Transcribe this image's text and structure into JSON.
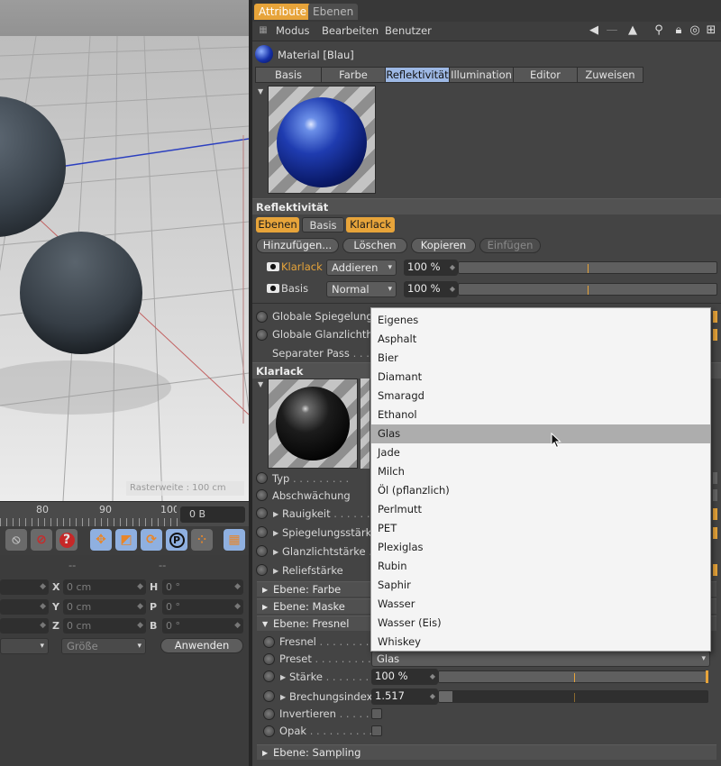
{
  "viewport": {
    "status_text": "Rasterweite : 100 cm"
  },
  "timeline": {
    "tick_labels": [
      "80",
      "90",
      "100"
    ],
    "frame_value": "0 B"
  },
  "left_toolbar": {
    "icons": [
      "scene-icon",
      "record-icon",
      "help-icon",
      "move-icon",
      "scale-icon",
      "rotate-icon",
      "parameter-icon",
      "points-icon",
      "film-icon"
    ]
  },
  "coordinates": {
    "header_dashes": [
      "--",
      "--"
    ],
    "rows": [
      {
        "a_value": "",
        "a_letter": "X",
        "a_field": "0 cm",
        "b_letter": "H",
        "b_field": "0 °"
      },
      {
        "a_value": "",
        "a_letter": "Y",
        "a_field": "0 cm",
        "b_letter": "P",
        "b_field": "0 °"
      },
      {
        "a_value": "",
        "a_letter": "Z",
        "a_field": "0 cm",
        "b_letter": "B",
        "b_field": "0 °"
      }
    ],
    "size_dropdown": "Größe",
    "apply_button": "Anwenden"
  },
  "panel": {
    "top_tabs": [
      "Attribute",
      "Ebenen"
    ],
    "menu": [
      "Modus",
      "Bearbeiten",
      "Benutzer"
    ],
    "material_title": "Material [Blau]",
    "channel_tabs": [
      "Basis",
      "Farbe",
      "Reflektivität",
      "Illumination",
      "Editor",
      "Zuweisen"
    ],
    "active_channel": "Reflektivität",
    "reflectivity": {
      "section_title": "Reflektivität",
      "layer_tabs": [
        "Ebenen",
        "Basis",
        "Klarlack"
      ],
      "buttons": [
        "Hinzufügen...",
        "Löschen",
        "Kopieren",
        "Einfügen"
      ],
      "layers": [
        {
          "name": "Klarlack",
          "mode": "Addieren",
          "percent": "100 %"
        },
        {
          "name": "Basis",
          "mode": "Normal",
          "percent": "100 %"
        }
      ],
      "global_rows": [
        "Globale Spiegelungs",
        "Globale Glanzlichthe",
        "Separater Pass"
      ]
    },
    "klarlack": {
      "section_title": "Klarlack",
      "properties": [
        "Typ",
        "Abschwächung",
        "Rauigkeit",
        "Spiegelungsstärke",
        "Glanzlichtstärke",
        "Reliefstärke"
      ]
    },
    "groups": [
      "Ebene: Farbe",
      "Ebene: Maske",
      "Ebene: Fresnel"
    ],
    "fresnel": {
      "rows": [
        {
          "label": "Fresnel",
          "value": ""
        },
        {
          "label": "Preset",
          "value": "Glas"
        },
        {
          "label": "Stärke",
          "value": "100 %"
        },
        {
          "label": "Brechungsindex",
          "value": "1.517"
        },
        {
          "label": "Invertieren",
          "value": ""
        },
        {
          "label": "Opak",
          "value": ""
        }
      ],
      "strength_fraction": 1.0,
      "ior_fraction": 0.05
    },
    "sampling_group": "Ebene: Sampling"
  },
  "popup": {
    "items": [
      "Eigenes",
      "Asphalt",
      "Bier",
      "Diamant",
      "Smaragd",
      "Ethanol",
      "Glas",
      "Jade",
      "Milch",
      "Öl (pflanzlich)",
      "Perlmutt",
      "PET",
      "Plexiglas",
      "Rubin",
      "Saphir",
      "Wasser",
      "Wasser (Eis)",
      "Whiskey"
    ],
    "selected": "Glas"
  },
  "colors": {
    "accent_orange": "#e7a43a",
    "active_tab_blue": "#9db8e4",
    "panel_bg": "#444444"
  }
}
